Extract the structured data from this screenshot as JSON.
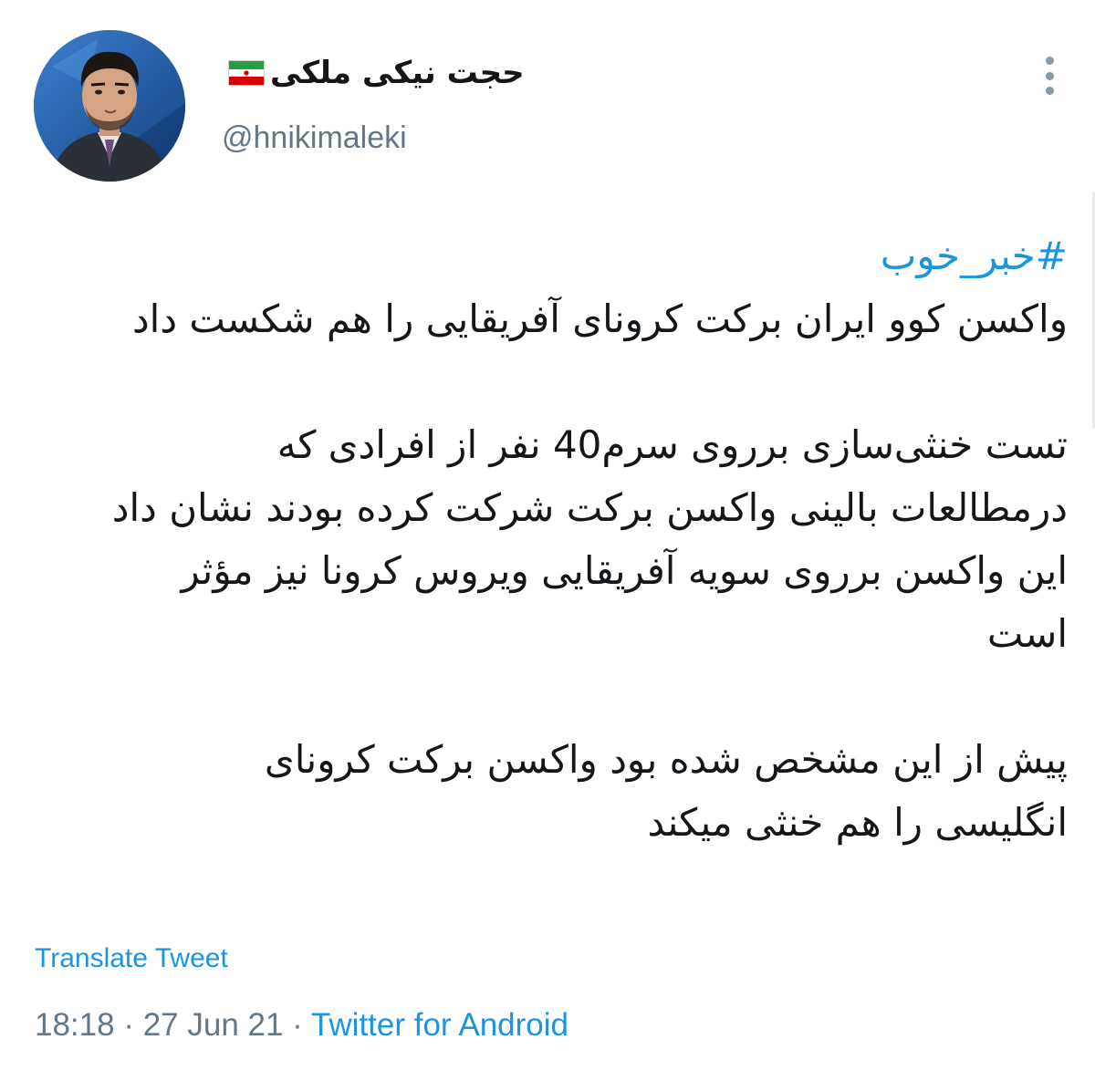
{
  "header": {
    "display_name": "حجت نیکی ملکی",
    "handle": "@hnikimaleki",
    "flag_icon": "iran-flag-icon",
    "more_icon": "more-vertical-icon"
  },
  "tweet": {
    "hashtag": "#خبر_خوب",
    "lines": [
      "واکسن کوو ایران برکت کرونای آفریقایی را هم شکست داد",
      "",
      "تست خنثی‌سازی برروی سرم40 نفر از افرادی که",
      "درمطالعات بالینی واکسن برکت شرکت کرده بودند نشان داد",
      "این واکسن برروی سویه آفریقایی ویروس کرونا نیز مؤثر",
      "است",
      "",
      "پیش از این مشخص شده بود واکسن برکت کرونای",
      "انگلیسی را هم خنثی میکند"
    ]
  },
  "actions": {
    "translate_label": "Translate Tweet"
  },
  "meta": {
    "time": "18:18",
    "separator": " · ",
    "date": "27 Jun 21",
    "source": "Twitter for Android"
  },
  "colors": {
    "link": "#1b95e0",
    "muted": "#657786",
    "text": "#14171a"
  }
}
